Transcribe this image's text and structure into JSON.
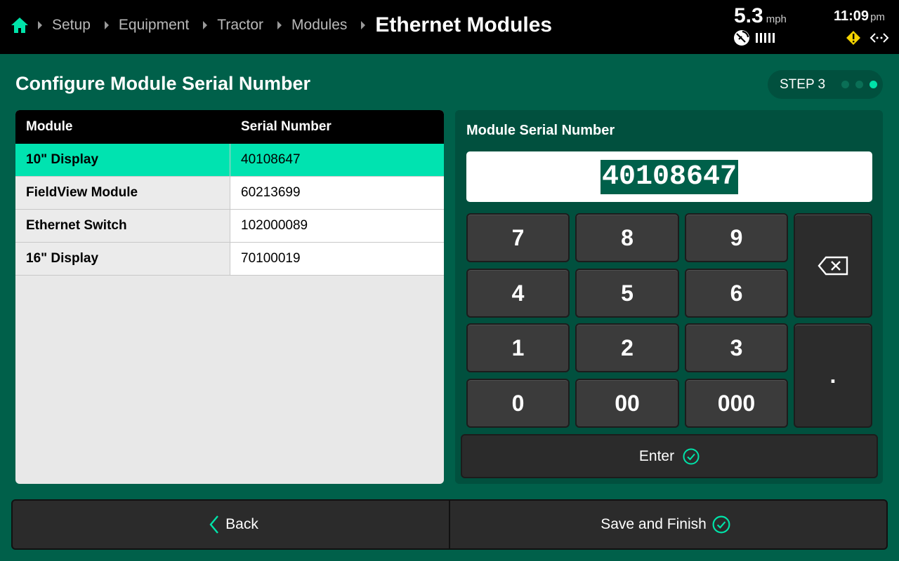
{
  "breadcrumb": {
    "items": [
      "Setup",
      "Equipment",
      "Tractor",
      "Modules"
    ],
    "current": "Ethernet Modules"
  },
  "status": {
    "speed_value": "5.3",
    "speed_unit": "mph",
    "time": "11:09",
    "ampm": "pm"
  },
  "page": {
    "title": "Configure Module Serial Number",
    "step_label": "STEP 3",
    "step_total": 3,
    "step_current": 3
  },
  "table": {
    "headers": [
      "Module",
      "Serial Number"
    ],
    "rows": [
      {
        "module": "10\" Display",
        "serial": "40108647",
        "selected": true
      },
      {
        "module": "FieldView Module",
        "serial": "60213699",
        "selected": false
      },
      {
        "module": "Ethernet Switch",
        "serial": "102000089",
        "selected": false
      },
      {
        "module": "16\" Display",
        "serial": "70100019",
        "selected": false
      }
    ]
  },
  "keypad": {
    "title": "Module Serial Number",
    "value": "40108647",
    "keys": [
      "7",
      "8",
      "9",
      "4",
      "5",
      "6",
      "1",
      "2",
      "3",
      "0",
      "00",
      "000"
    ],
    "decimal": ".",
    "enter_label": "Enter"
  },
  "footer": {
    "back_label": "Back",
    "save_label": "Save and Finish"
  },
  "colors": {
    "background": "#00604a",
    "accent": "#00e3a9",
    "panel": "#01503e",
    "topbar": "#000000"
  }
}
